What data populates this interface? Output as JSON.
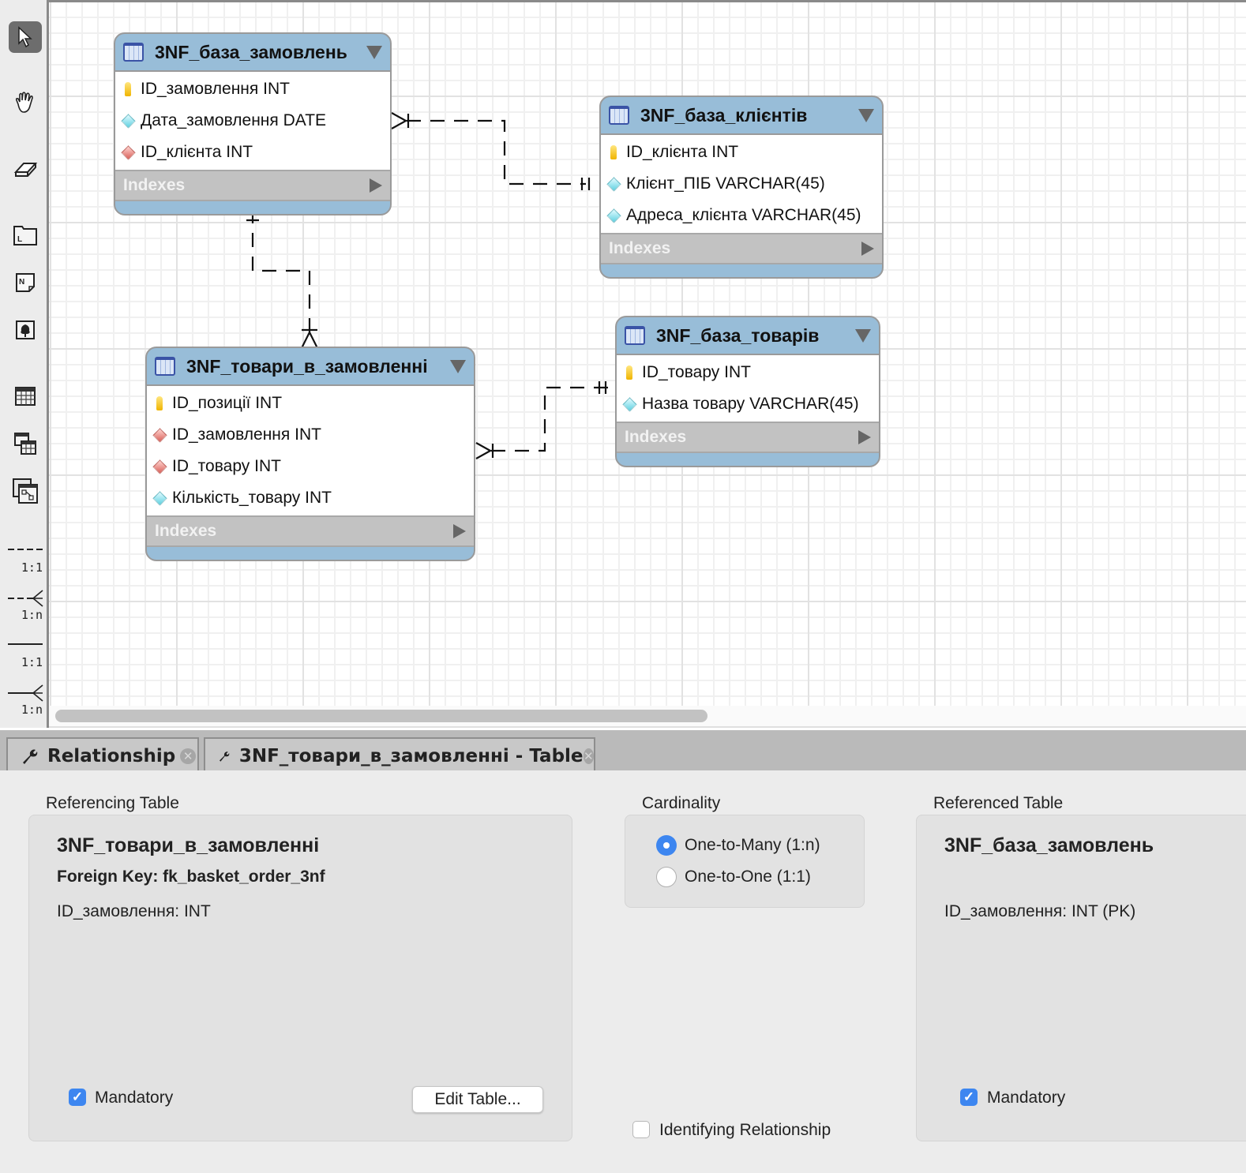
{
  "toolbar": {
    "tools": [
      {
        "name": "pointer",
        "active": true
      },
      {
        "name": "hand"
      },
      {
        "name": "eraser"
      },
      {
        "name": "layer"
      },
      {
        "name": "note"
      },
      {
        "name": "image"
      },
      {
        "name": "table"
      },
      {
        "name": "view"
      },
      {
        "name": "routine-group"
      }
    ],
    "relationship_tools": [
      {
        "style": "dashed",
        "label": "1:1"
      },
      {
        "style": "dashed",
        "label": "1:n"
      },
      {
        "style": "solid",
        "label": "1:1"
      },
      {
        "style": "solid",
        "label": "1:n"
      }
    ]
  },
  "diagram": {
    "indexes_label": "Indexes",
    "tables": [
      {
        "id": "orders",
        "title": "3NF_база_замовлень",
        "columns": [
          {
            "name": "ID_замовлення INT",
            "kind": "pk"
          },
          {
            "name": "Дата_замовлення DATE",
            "kind": "attr"
          },
          {
            "name": "ID_клієнта INT",
            "kind": "fk"
          }
        ]
      },
      {
        "id": "clients",
        "title": "3NF_база_клієнтів",
        "columns": [
          {
            "name": "ID_клієнта INT",
            "kind": "pk"
          },
          {
            "name": "Клієнт_ПІБ VARCHAR(45)",
            "kind": "attr"
          },
          {
            "name": "Адреса_клієнта VARCHAR(45)",
            "kind": "attr"
          }
        ]
      },
      {
        "id": "order_items",
        "title": "3NF_товари_в_замовленні",
        "columns": [
          {
            "name": "ID_позиції INT",
            "kind": "pk"
          },
          {
            "name": "ID_замовлення INT",
            "kind": "fk"
          },
          {
            "name": "ID_товару INT",
            "kind": "fk"
          },
          {
            "name": "Кількість_товару INT",
            "kind": "attr"
          }
        ]
      },
      {
        "id": "products",
        "title": "3NF_база_товарів",
        "columns": [
          {
            "name": "ID_товару INT",
            "kind": "pk"
          },
          {
            "name": "Назва товару VARCHAR(45)",
            "kind": "attr"
          }
        ]
      }
    ],
    "relationships": [
      {
        "from": "orders",
        "to": "clients",
        "cardinality": "many-to-one",
        "identifying": false
      },
      {
        "from": "order_items",
        "to": "orders",
        "cardinality": "many-to-one",
        "identifying": false
      },
      {
        "from": "order_items",
        "to": "products",
        "cardinality": "many-to-one",
        "identifying": false
      }
    ]
  },
  "tabs": [
    {
      "label": "Relationship",
      "icon": "wrench-icon",
      "active": true
    },
    {
      "label": "3NF_товари_в_замовленні - Table",
      "icon": "wrench-icon",
      "active": false
    }
  ],
  "editor": {
    "referencing": {
      "section_label": "Referencing Table",
      "table_name": "3NF_товари_в_замовленні",
      "foreign_key": "Foreign Key: fk_basket_order_3nf",
      "column": "ID_замовлення: INT",
      "mandatory_label": "Mandatory",
      "mandatory": true,
      "edit_button": "Edit Table..."
    },
    "cardinality": {
      "section_label": "Cardinality",
      "options": [
        {
          "label": "One-to-Many (1:n)",
          "selected": true
        },
        {
          "label": "One-to-One (1:1)",
          "selected": false
        }
      ],
      "identifying_label": "Identifying Relationship",
      "identifying": false
    },
    "referenced": {
      "section_label": "Referenced Table",
      "table_name": "3NF_база_замовлень",
      "column": "ID_замовлення: INT (PK)",
      "mandatory_label": "Mandatory",
      "mandatory": true
    },
    "colors": {
      "accent": "#3d86f0",
      "table_header": "#98bdd8"
    }
  }
}
